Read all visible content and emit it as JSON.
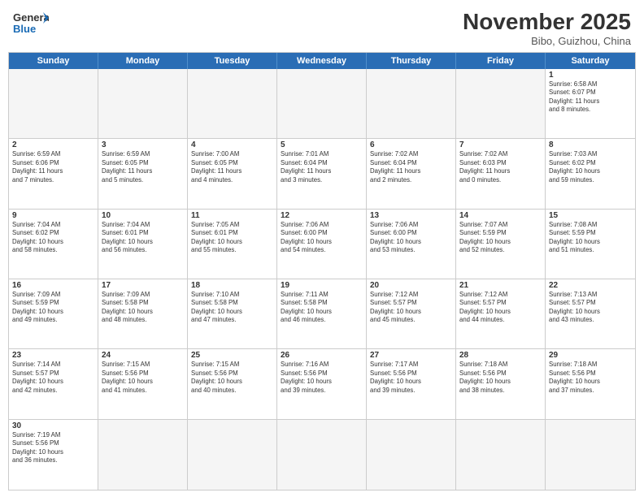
{
  "header": {
    "logo_general": "General",
    "logo_blue": "Blue",
    "month_title": "November 2025",
    "location": "Bibo, Guizhou, China"
  },
  "days": [
    "Sunday",
    "Monday",
    "Tuesday",
    "Wednesday",
    "Thursday",
    "Friday",
    "Saturday"
  ],
  "weeks": [
    [
      {
        "num": "",
        "info": "",
        "empty": true
      },
      {
        "num": "",
        "info": "",
        "empty": true
      },
      {
        "num": "",
        "info": "",
        "empty": true
      },
      {
        "num": "",
        "info": "",
        "empty": true
      },
      {
        "num": "",
        "info": "",
        "empty": true
      },
      {
        "num": "",
        "info": "",
        "empty": true
      },
      {
        "num": "1",
        "info": "Sunrise: 6:58 AM\nSunset: 6:07 PM\nDaylight: 11 hours\nand 8 minutes.",
        "empty": false
      }
    ],
    [
      {
        "num": "2",
        "info": "Sunrise: 6:59 AM\nSunset: 6:06 PM\nDaylight: 11 hours\nand 7 minutes.",
        "empty": false
      },
      {
        "num": "3",
        "info": "Sunrise: 6:59 AM\nSunset: 6:05 PM\nDaylight: 11 hours\nand 5 minutes.",
        "empty": false
      },
      {
        "num": "4",
        "info": "Sunrise: 7:00 AM\nSunset: 6:05 PM\nDaylight: 11 hours\nand 4 minutes.",
        "empty": false
      },
      {
        "num": "5",
        "info": "Sunrise: 7:01 AM\nSunset: 6:04 PM\nDaylight: 11 hours\nand 3 minutes.",
        "empty": false
      },
      {
        "num": "6",
        "info": "Sunrise: 7:02 AM\nSunset: 6:04 PM\nDaylight: 11 hours\nand 2 minutes.",
        "empty": false
      },
      {
        "num": "7",
        "info": "Sunrise: 7:02 AM\nSunset: 6:03 PM\nDaylight: 11 hours\nand 0 minutes.",
        "empty": false
      },
      {
        "num": "8",
        "info": "Sunrise: 7:03 AM\nSunset: 6:02 PM\nDaylight: 10 hours\nand 59 minutes.",
        "empty": false
      }
    ],
    [
      {
        "num": "9",
        "info": "Sunrise: 7:04 AM\nSunset: 6:02 PM\nDaylight: 10 hours\nand 58 minutes.",
        "empty": false
      },
      {
        "num": "10",
        "info": "Sunrise: 7:04 AM\nSunset: 6:01 PM\nDaylight: 10 hours\nand 56 minutes.",
        "empty": false
      },
      {
        "num": "11",
        "info": "Sunrise: 7:05 AM\nSunset: 6:01 PM\nDaylight: 10 hours\nand 55 minutes.",
        "empty": false
      },
      {
        "num": "12",
        "info": "Sunrise: 7:06 AM\nSunset: 6:00 PM\nDaylight: 10 hours\nand 54 minutes.",
        "empty": false
      },
      {
        "num": "13",
        "info": "Sunrise: 7:06 AM\nSunset: 6:00 PM\nDaylight: 10 hours\nand 53 minutes.",
        "empty": false
      },
      {
        "num": "14",
        "info": "Sunrise: 7:07 AM\nSunset: 5:59 PM\nDaylight: 10 hours\nand 52 minutes.",
        "empty": false
      },
      {
        "num": "15",
        "info": "Sunrise: 7:08 AM\nSunset: 5:59 PM\nDaylight: 10 hours\nand 51 minutes.",
        "empty": false
      }
    ],
    [
      {
        "num": "16",
        "info": "Sunrise: 7:09 AM\nSunset: 5:59 PM\nDaylight: 10 hours\nand 49 minutes.",
        "empty": false
      },
      {
        "num": "17",
        "info": "Sunrise: 7:09 AM\nSunset: 5:58 PM\nDaylight: 10 hours\nand 48 minutes.",
        "empty": false
      },
      {
        "num": "18",
        "info": "Sunrise: 7:10 AM\nSunset: 5:58 PM\nDaylight: 10 hours\nand 47 minutes.",
        "empty": false
      },
      {
        "num": "19",
        "info": "Sunrise: 7:11 AM\nSunset: 5:58 PM\nDaylight: 10 hours\nand 46 minutes.",
        "empty": false
      },
      {
        "num": "20",
        "info": "Sunrise: 7:12 AM\nSunset: 5:57 PM\nDaylight: 10 hours\nand 45 minutes.",
        "empty": false
      },
      {
        "num": "21",
        "info": "Sunrise: 7:12 AM\nSunset: 5:57 PM\nDaylight: 10 hours\nand 44 minutes.",
        "empty": false
      },
      {
        "num": "22",
        "info": "Sunrise: 7:13 AM\nSunset: 5:57 PM\nDaylight: 10 hours\nand 43 minutes.",
        "empty": false
      }
    ],
    [
      {
        "num": "23",
        "info": "Sunrise: 7:14 AM\nSunset: 5:57 PM\nDaylight: 10 hours\nand 42 minutes.",
        "empty": false
      },
      {
        "num": "24",
        "info": "Sunrise: 7:15 AM\nSunset: 5:56 PM\nDaylight: 10 hours\nand 41 minutes.",
        "empty": false
      },
      {
        "num": "25",
        "info": "Sunrise: 7:15 AM\nSunset: 5:56 PM\nDaylight: 10 hours\nand 40 minutes.",
        "empty": false
      },
      {
        "num": "26",
        "info": "Sunrise: 7:16 AM\nSunset: 5:56 PM\nDaylight: 10 hours\nand 39 minutes.",
        "empty": false
      },
      {
        "num": "27",
        "info": "Sunrise: 7:17 AM\nSunset: 5:56 PM\nDaylight: 10 hours\nand 39 minutes.",
        "empty": false
      },
      {
        "num": "28",
        "info": "Sunrise: 7:18 AM\nSunset: 5:56 PM\nDaylight: 10 hours\nand 38 minutes.",
        "empty": false
      },
      {
        "num": "29",
        "info": "Sunrise: 7:18 AM\nSunset: 5:56 PM\nDaylight: 10 hours\nand 37 minutes.",
        "empty": false
      }
    ],
    [
      {
        "num": "30",
        "info": "Sunrise: 7:19 AM\nSunset: 5:56 PM\nDaylight: 10 hours\nand 36 minutes.",
        "empty": false
      },
      {
        "num": "",
        "info": "",
        "empty": true
      },
      {
        "num": "",
        "info": "",
        "empty": true
      },
      {
        "num": "",
        "info": "",
        "empty": true
      },
      {
        "num": "",
        "info": "",
        "empty": true
      },
      {
        "num": "",
        "info": "",
        "empty": true
      },
      {
        "num": "",
        "info": "",
        "empty": true
      }
    ]
  ]
}
